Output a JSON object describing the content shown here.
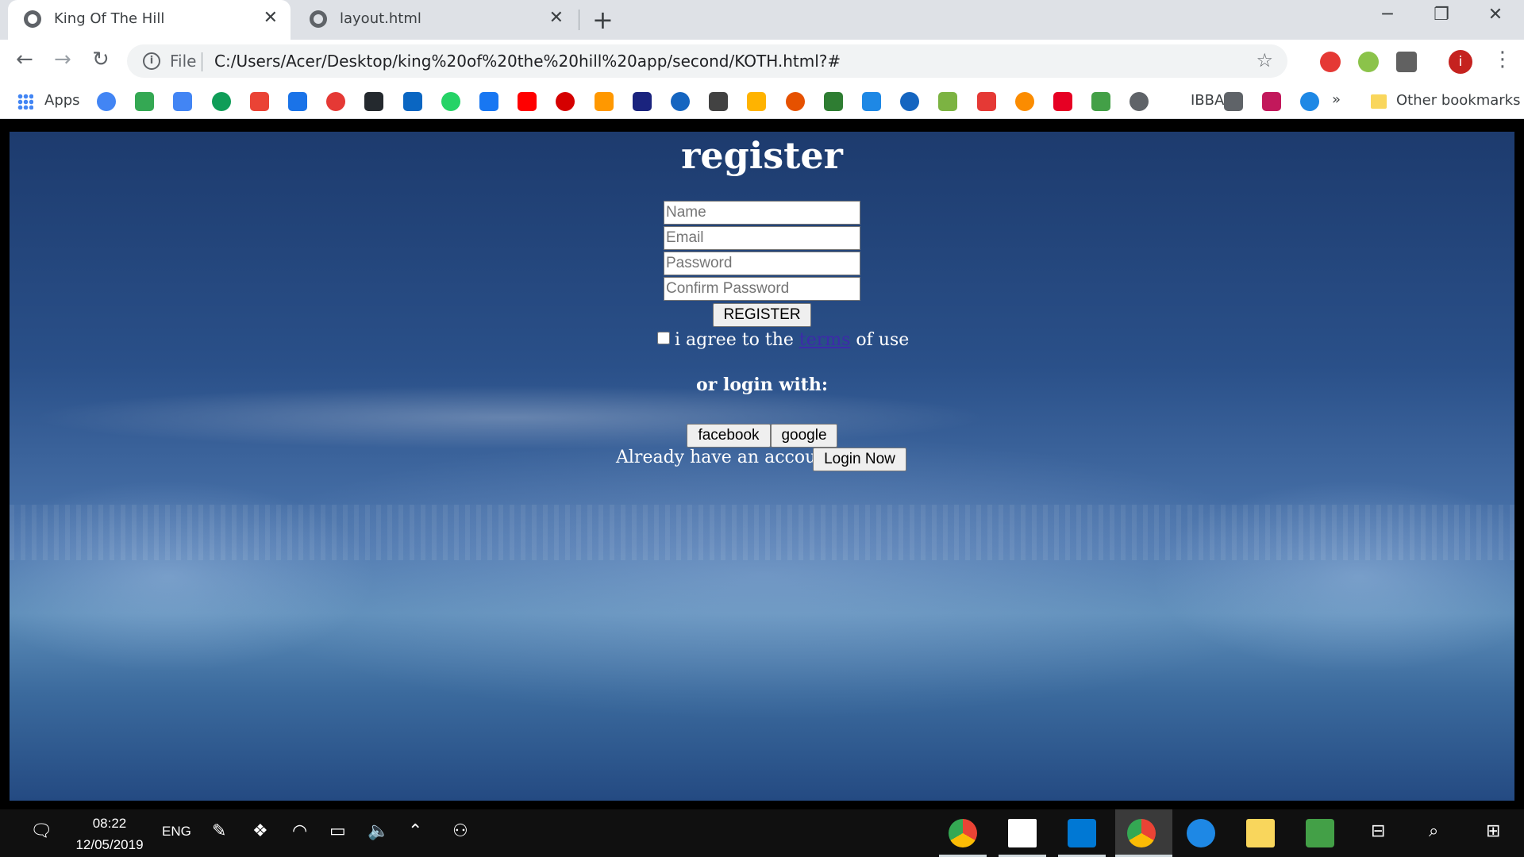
{
  "browser": {
    "tabs": [
      {
        "title": "King Of The Hill",
        "close": "✕"
      },
      {
        "title": "layout.html",
        "close": "✕"
      }
    ],
    "new_tab": "+",
    "window_controls": {
      "minimize": "─",
      "restore": "❐",
      "close": "✕"
    },
    "nav": {
      "back": "←",
      "forward": "→",
      "reload": "↻"
    },
    "address": {
      "info_icon": "i",
      "scheme_label": "File",
      "url": "C:/Users/Acer/Desktop/king%20of%20the%20hill%20app/second/KOTH.html?#",
      "star": "☆"
    },
    "profile_initial": "i",
    "menu": "⋮",
    "bookmarks": {
      "apps_label": "Apps",
      "ibba_label": "IBBA",
      "overflow": "»",
      "other_label": "Other bookmarks",
      "icon_colors": [
        "#4285f4",
        "#34a853",
        "#4285f4",
        "#0f9d58",
        "#ea4335",
        "#1a73e8",
        "#e53935",
        "#24292e",
        "#0a66c2",
        "#25d366",
        "#1877f2",
        "#ff0000",
        "#d50000",
        "#ff9800",
        "#1a237e",
        "#1565c0",
        "#424242",
        "#ffb300",
        "#e65100",
        "#2e7d32",
        "#1e88e5",
        "#1565c0",
        "#7cb342",
        "#e53935",
        "#fb8c00",
        "#e60023",
        "#43a047",
        "#5f6368",
        "#5f6368",
        "#c2185b",
        "#1e88e5"
      ]
    }
  },
  "page": {
    "title": "register",
    "fields": {
      "name_placeholder": "Name",
      "email_placeholder": "Email",
      "password_placeholder": "Password",
      "confirm_placeholder": "Confirm Password"
    },
    "register_button": "REGISTER",
    "agree_prefix": "i agree to the ",
    "terms_link": "terms",
    "agree_suffix": " of use",
    "or_login": "or login with:",
    "facebook_button": "facebook",
    "google_button": "google",
    "already_text": "Already have an account?",
    "login_button": "Login Now"
  },
  "taskbar": {
    "time": "08:22",
    "date": "12/05/2019",
    "language": "ENG"
  }
}
